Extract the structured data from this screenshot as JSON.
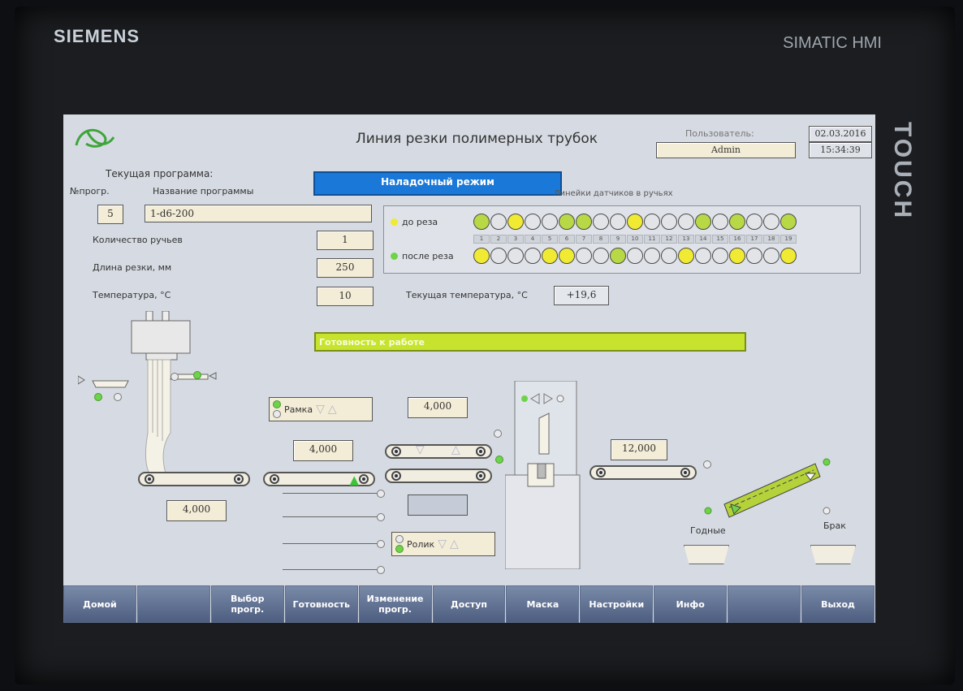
{
  "device": {
    "brand": "SIEMENS",
    "model": "SIMATIC HMI",
    "side_label": "TOUCH"
  },
  "header": {
    "title": "Линия резки полимерных трубок",
    "user_label": "Пользователь:",
    "user": "Admin",
    "date": "02.03.2016",
    "time": "15:34:39"
  },
  "program": {
    "current_label": "Текущая программа:",
    "num_label": "№прогр.",
    "name_label": "Название программы",
    "num": "5",
    "name": "1-d6-200"
  },
  "mode_banner": "Наладочный режим",
  "params": {
    "streams_label": "Количество ручьев",
    "streams": "1",
    "length_label": "Длина резки, мм",
    "length": "250",
    "temp_label": "Температура, °С",
    "temp": "10",
    "cur_temp_label": "Текущая температура, °С",
    "cur_temp": "+19,6"
  },
  "sensors": {
    "title": "Линейки датчиков в ручьях",
    "before_label": "до реза",
    "after_label": "после реза",
    "before": [
      "g",
      "o",
      "y",
      "o",
      "o",
      "g",
      "g",
      "o",
      "o",
      "y",
      "o",
      "o",
      "o",
      "g",
      "o",
      "g",
      "o",
      "o",
      "g"
    ],
    "after": [
      "y",
      "o",
      "o",
      "o",
      "y",
      "y",
      "o",
      "o",
      "g",
      "o",
      "o",
      "o",
      "y",
      "o",
      "o",
      "y",
      "o",
      "o",
      "y"
    ],
    "numbers": [
      "1",
      "2",
      "3",
      "4",
      "5",
      "6",
      "7",
      "8",
      "9",
      "10",
      "11",
      "12",
      "13",
      "14",
      "15",
      "16",
      "17",
      "18",
      "19"
    ]
  },
  "status_banner": "Готовность к работе",
  "machine": {
    "v1": "4,000",
    "v2": "4,000",
    "v3": "4,000",
    "v4": "12,000",
    "frame_label": "Рамка",
    "roller_label": "Ролик",
    "good_label": "Годные",
    "reject_label": "Брак"
  },
  "toolbar": {
    "buttons": [
      "Домой",
      "",
      "Выбор\nпрогр.",
      "Готовность",
      "Изменение\nпрогр.",
      "Доступ",
      "Маска",
      "Настройки",
      "Инфо",
      "",
      "Выход"
    ]
  },
  "colors": {
    "accent_blue": "#1a78d8",
    "ready_green": "#c8e32e",
    "sensor_yellow": "#f0ea32",
    "sensor_green": "#b8d846"
  }
}
